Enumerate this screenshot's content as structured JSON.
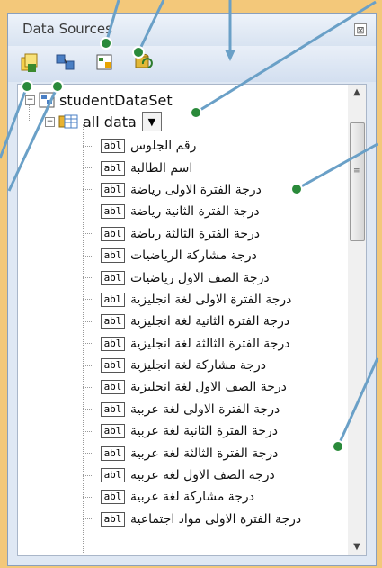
{
  "window": {
    "title": "Data Sources",
    "close_glyph": "⊠"
  },
  "toolbar": {
    "buttons": [
      {
        "icon": "add-data-source-icon"
      },
      {
        "icon": "edit-dataset-designer-icon"
      },
      {
        "icon": "configure-dataset-icon"
      },
      {
        "icon": "refresh-icon"
      }
    ]
  },
  "tree": {
    "root": {
      "expander": "−",
      "label": "studentDataSet"
    },
    "table": {
      "expander": "−",
      "label": "all data",
      "dropdown_glyph": "▼"
    },
    "field_type_label": "abl",
    "fields": [
      "رقم الجلوس",
      "اسم الطالبة",
      "درجة الفترة الاولى رياضة",
      "درجة الفترة الثانية رياضة",
      "درجة الفترة الثالثة رياضة",
      "درجة مشاركة الرياضيات",
      "درجة الصف الاول رياضيات",
      "درجة الفترة الاولى لغة انجليزية",
      "درجة الفترة الثانية لغة انجليزية",
      "درجة الفترة الثالثة لغة انجليزية",
      "درجة مشاركة لغة انجليزية",
      "درجة الصف الاول لغة انجليزية",
      "درجة الفترة الاولى لغة عربية",
      "درجة الفترة الثانية لغة عربية",
      "درجة الفترة الثالثة لغة عربية",
      "درجة الصف الاول لغة عربية",
      "درجة مشاركة لغة عربية",
      "درجة الفترة الاولى مواد اجتماعية"
    ]
  },
  "scrollbar": {
    "up_glyph": "▲",
    "down_glyph": "▼",
    "grip_glyph": "≡"
  },
  "colors": {
    "background": "#f3c87a",
    "callout_line": "#6aa0c7",
    "callout_dot": "#2a8a3a"
  }
}
